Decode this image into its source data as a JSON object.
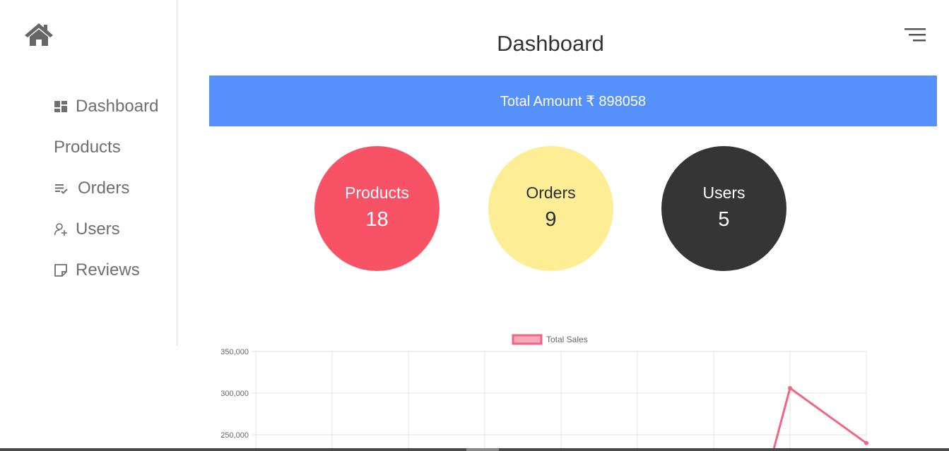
{
  "sidebar": {
    "home_icon": "home-icon",
    "items": [
      {
        "label": "Dashboard",
        "icon": "dashboard-icon"
      },
      {
        "label": "Products",
        "icon": ""
      },
      {
        "label": "Orders",
        "icon": "list-check-icon"
      },
      {
        "label": "Users",
        "icon": "user-add-icon"
      },
      {
        "label": "Reviews",
        "icon": "note-icon"
      }
    ]
  },
  "header": {
    "title": "Dashboard",
    "menu_icon": "menu-lines-icon"
  },
  "summary": {
    "total_amount_label": "Total Amount ₹ 898058",
    "banner_color": "#5590fb"
  },
  "stats": [
    {
      "label": "Products",
      "value": "18",
      "color": "#f85266"
    },
    {
      "label": "Orders",
      "value": "9",
      "color": "#fdee95"
    },
    {
      "label": "Users",
      "value": "5",
      "color": "#353535"
    }
  ],
  "chart_data": {
    "type": "line",
    "series": [
      {
        "name": "Total Sales",
        "color": "#f06583",
        "points": [
          [
            7,
            306000
          ],
          [
            8,
            240000
          ]
        ]
      }
    ],
    "visible_segment_start": [
      6.75,
      220000
    ],
    "y_ticks": [
      "350,000",
      "300,000",
      "250,000"
    ],
    "ylim_visible": [
      250000,
      350000
    ],
    "x_grid_count": 9,
    "legend_position": "top-center",
    "grid": true
  }
}
